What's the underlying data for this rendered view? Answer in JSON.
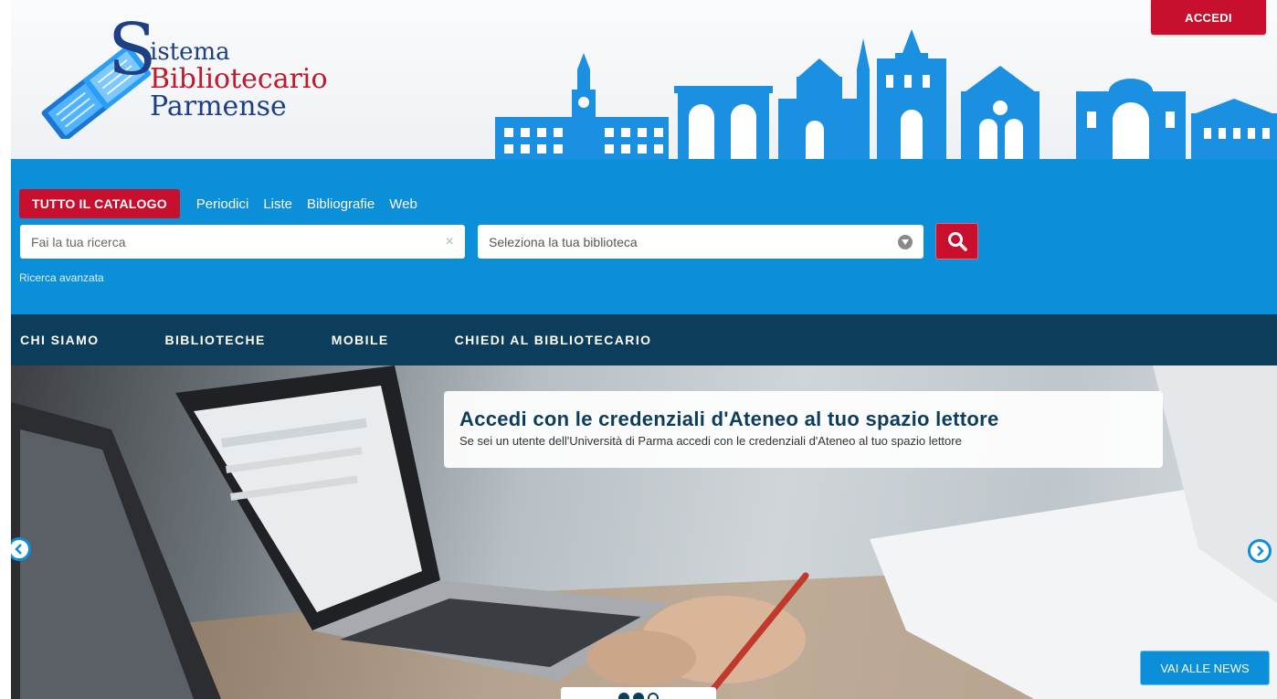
{
  "header": {
    "logo": {
      "line1": "istema",
      "line2": "Bibliotecario",
      "line3": "Parmense",
      "initial": "S"
    },
    "login_label": "ACCEDI"
  },
  "search": {
    "tabs": [
      "TUTTO IL CATALOGO",
      "Periodici",
      "Liste",
      "Bibliografie",
      "Web"
    ],
    "active_tab": "TUTTO IL CATALOGO",
    "query_placeholder": "Fai la tua ricerca",
    "clear_icon": "×",
    "library_placeholder": "Seleziona la tua biblioteca",
    "advanced_link": "Ricerca avanzata"
  },
  "nav": {
    "items": [
      "CHI SIAMO",
      "BIBLIOTECHE",
      "MOBILE",
      "CHIEDI AL BIBLIOTECARIO"
    ]
  },
  "hero": {
    "title": "Accedi con le credenziali d'Ateneo al tuo spazio lettore",
    "subtitle": "Se sei un utente dell'Università di Parma accedi con le credenziali d'Ateneo al tuo spazio lettore",
    "news_button": "VAI ALLE NEWS",
    "slides_total": 3,
    "active_slide": 2
  },
  "colors": {
    "brand_red": "#c8102e",
    "brand_blue": "#0b8fd9",
    "nav_dark": "#0c3d5c"
  },
  "icons": {
    "search": "search-icon",
    "caret": "caret-down-icon",
    "prev": "chevron-left-icon",
    "next": "chevron-right-icon"
  }
}
